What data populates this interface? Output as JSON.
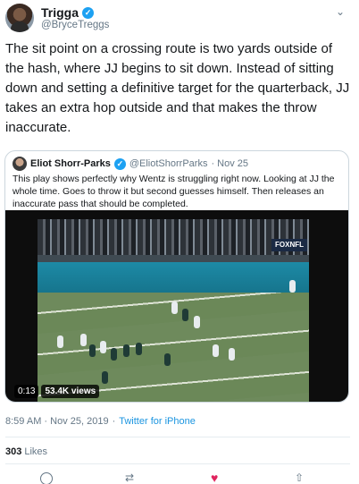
{
  "tweet": {
    "author": {
      "name": "Trigga",
      "handle": "@BryceTreggs",
      "verified": true
    },
    "text": "The sit point on a crossing route is two yards outside of the hash, where JJ begins to sit down. Instead of sitting down and setting a definitive target for the quarterback, JJ takes an extra hop outside and that makes the throw inaccurate.",
    "timestamp": "8:59 AM · Nov 25, 2019",
    "separator": "·",
    "source": "Twitter for iPhone",
    "likes_count": "303",
    "likes_label": "Likes"
  },
  "quote": {
    "author": {
      "name": "Eliot Shorr-Parks",
      "handle": "@EliotShorrParks",
      "date": "· Nov 25",
      "verified": true
    },
    "text": "This play shows perfectly why Wentz is struggling right now. Looking at JJ the whole time. Goes to throw it but second guesses himself. Then releases an inaccurate pass that should be completed.",
    "video": {
      "time": "0:13",
      "views": "53.4K views",
      "network_logo": "FOXNFL"
    }
  },
  "icons": {
    "verified": "verified-badge-icon",
    "menu": "chevron-down-icon",
    "reply": "reply-icon",
    "retweet": "retweet-icon",
    "like": "heart-icon",
    "share": "share-icon"
  },
  "colors": {
    "accent": "#1da1f2",
    "link": "#1b95e0",
    "like": "#e0245e",
    "muted": "#657786"
  }
}
